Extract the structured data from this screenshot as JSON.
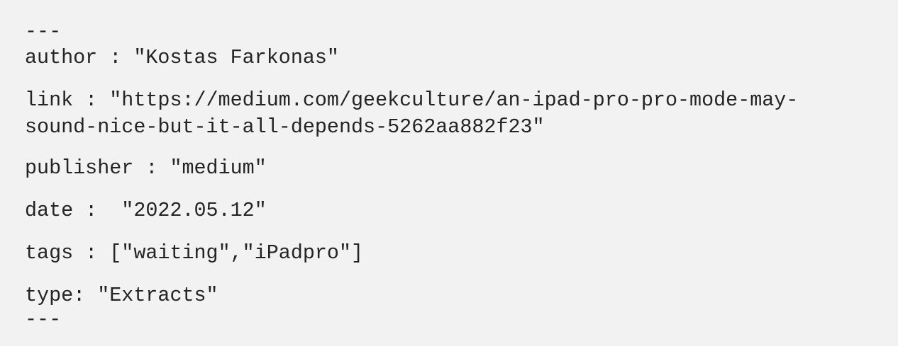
{
  "frontmatter": {
    "delimiter_open": "---",
    "author": "author : \"Kostas Farkonas\"",
    "link": "link : \"https://medium.com/geekculture/an-ipad-pro-pro-mode-may-sound-nice-but-it-all-depends-5262aa882f23\"",
    "publisher": "publisher : \"medium\"",
    "date": "date :  \"2022.05.12\"",
    "tags": "tags : [\"waiting\",\"iPadpro\"]",
    "type": "type: \"Extracts\"",
    "delimiter_close": "---"
  }
}
